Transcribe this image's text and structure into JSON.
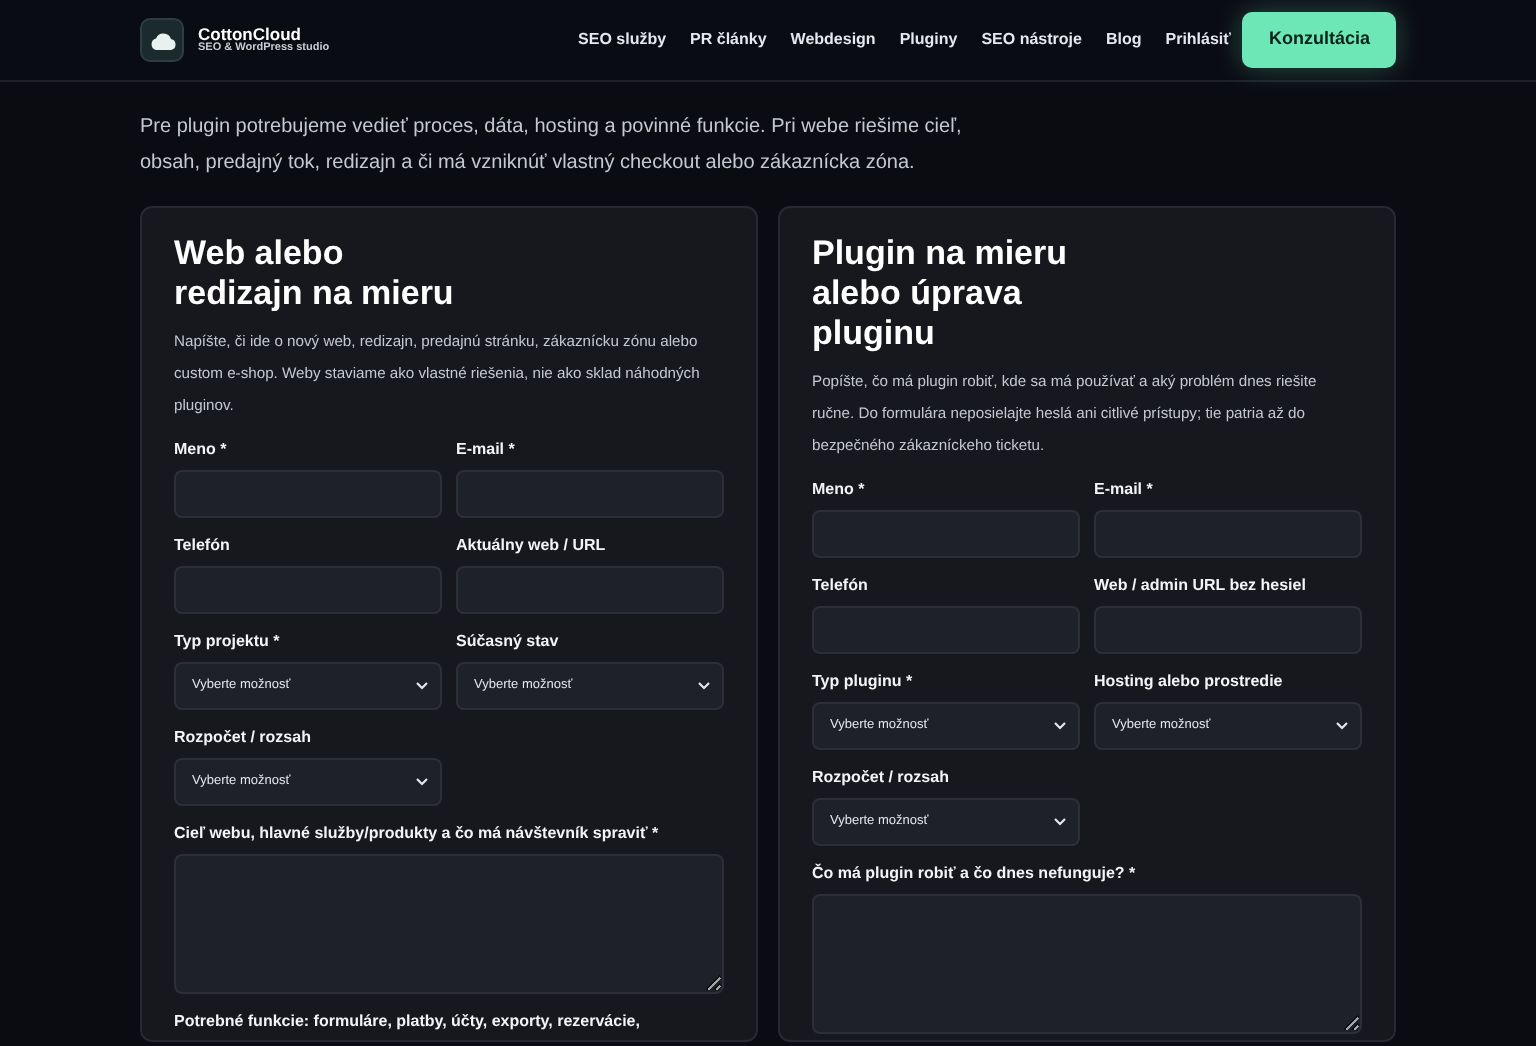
{
  "header": {
    "brand": "CottonCloud",
    "tagline": "SEO & WordPress studio",
    "nav": [
      {
        "label": "SEO služby"
      },
      {
        "label": "PR články"
      },
      {
        "label": "Webdesign"
      },
      {
        "label": "Pluginy"
      },
      {
        "label": "SEO nástroje"
      },
      {
        "label": "Blog"
      },
      {
        "label": "Prihlásiť"
      }
    ],
    "cta": "Konzultácia"
  },
  "intro": "Pre plugin potrebujeme vedieť proces, dáta, hosting a povinné funkcie. Pri webe riešime cieľ, obsah, predajný tok, redizajn a či má vzniknúť vlastný checkout alebo zákaznícka zóna.",
  "cards": [
    {
      "title": "Web alebo redizajn na mieru",
      "description": "Napíšte, či ide o nový web, redizajn, predajnú stránku, zákaznícku zónu alebo custom e-shop. Weby staviame ako vlastné riešenia, nie ako sklad náhodných pluginov.",
      "fields": [
        {
          "kind": "input",
          "label": "Meno *"
        },
        {
          "kind": "input",
          "label": "E-mail *"
        },
        {
          "kind": "input",
          "label": "Telefón"
        },
        {
          "kind": "input",
          "label": "Aktuálny web / URL"
        },
        {
          "kind": "select",
          "label": "Typ projektu *",
          "value": "Vyberte možnosť"
        },
        {
          "kind": "select",
          "label": "Súčasný stav",
          "value": "Vyberte možnosť"
        },
        {
          "kind": "select",
          "label": "Rozpočet / rozsah",
          "value": "Vyberte možnosť"
        },
        {
          "kind": "textarea",
          "label": "Cieľ webu, hlavné služby/produkty a čo má návštevník spraviť *"
        },
        {
          "kind": "label",
          "label": "Potrebné funkcie: formuláre, platby, účty, exporty, rezervácie,"
        }
      ]
    },
    {
      "title": "Plugin na mieru alebo úprava pluginu",
      "description": "Popíšte, čo má plugin robiť, kde sa má používať a aký problém dnes riešite ručne. Do formulára neposielajte heslá ani citlivé prístupy; tie patria až do bezpečného zákazníckeho ticketu.",
      "fields": [
        {
          "kind": "input",
          "label": "Meno *"
        },
        {
          "kind": "input",
          "label": "E-mail *"
        },
        {
          "kind": "input",
          "label": "Telefón"
        },
        {
          "kind": "input",
          "label": "Web / admin URL bez hesiel"
        },
        {
          "kind": "select",
          "label": "Typ pluginu *",
          "value": "Vyberte možnosť"
        },
        {
          "kind": "select",
          "label": "Hosting alebo prostredie",
          "value": "Vyberte možnosť"
        },
        {
          "kind": "select",
          "label": "Rozpočet / rozsah",
          "value": "Vyberte možnosť"
        },
        {
          "kind": "textarea",
          "label": "Čo má plugin robiť a čo dnes nefunguje? *"
        }
      ]
    }
  ]
}
